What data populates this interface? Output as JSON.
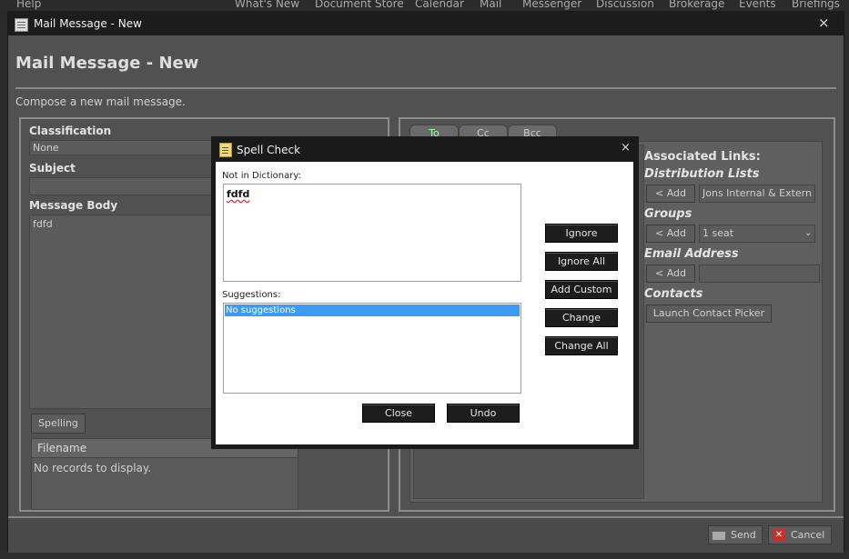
{
  "top_menu": [
    "Help",
    "What's New",
    "Document Store",
    "Calendar",
    "Mail",
    "Messenger",
    "Discussion",
    "Brokerage",
    "Events",
    "Briefings"
  ],
  "window": {
    "title": "Mail Message - New",
    "header": "Mail Message - New",
    "subtitle": "Compose a new mail message.",
    "close_glyph": "×"
  },
  "form": {
    "classification_label": "Classification",
    "classification_value": "None",
    "subject_label": "Subject",
    "subject_value": "",
    "body_label": "Message Body",
    "body_value": "fdfd",
    "spelling_button": "Spelling",
    "attachments_header": "Filename",
    "attachments_empty": "No records to display."
  },
  "recipients": {
    "tabs": [
      "To",
      "Cc",
      "Bcc"
    ],
    "associated_links_label": "Associated Links:",
    "distribution_lists_label": "Distribution Lists",
    "distribution_lists_value": "Jons Internal & Extern",
    "groups_label": "Groups",
    "groups_value": "1 seat",
    "email_address_label": "Email Address",
    "contacts_label": "Contacts",
    "add_button": "< Add",
    "contact_picker_button": "Launch Contact Picker"
  },
  "footer": {
    "send": "Send",
    "cancel": "Cancel"
  },
  "spell_dialog": {
    "title": "Spell Check",
    "close_glyph": "×",
    "not_in_dictionary_label": "Not in Dictionary:",
    "misspelled_word": "fdfd",
    "suggestions_label": "Suggestions:",
    "suggestions": [
      "No suggestions"
    ],
    "buttons": {
      "ignore": "Ignore",
      "ignore_all": "Ignore All",
      "add_custom": "Add Custom",
      "change": "Change",
      "change_all": "Change All",
      "close": "Close",
      "undo": "Undo"
    }
  },
  "colors": {
    "window_bg": "#515151",
    "titlebar": "#1c1c1c",
    "selection": "#3d9bf3",
    "cancel_red": "#c8302c"
  }
}
